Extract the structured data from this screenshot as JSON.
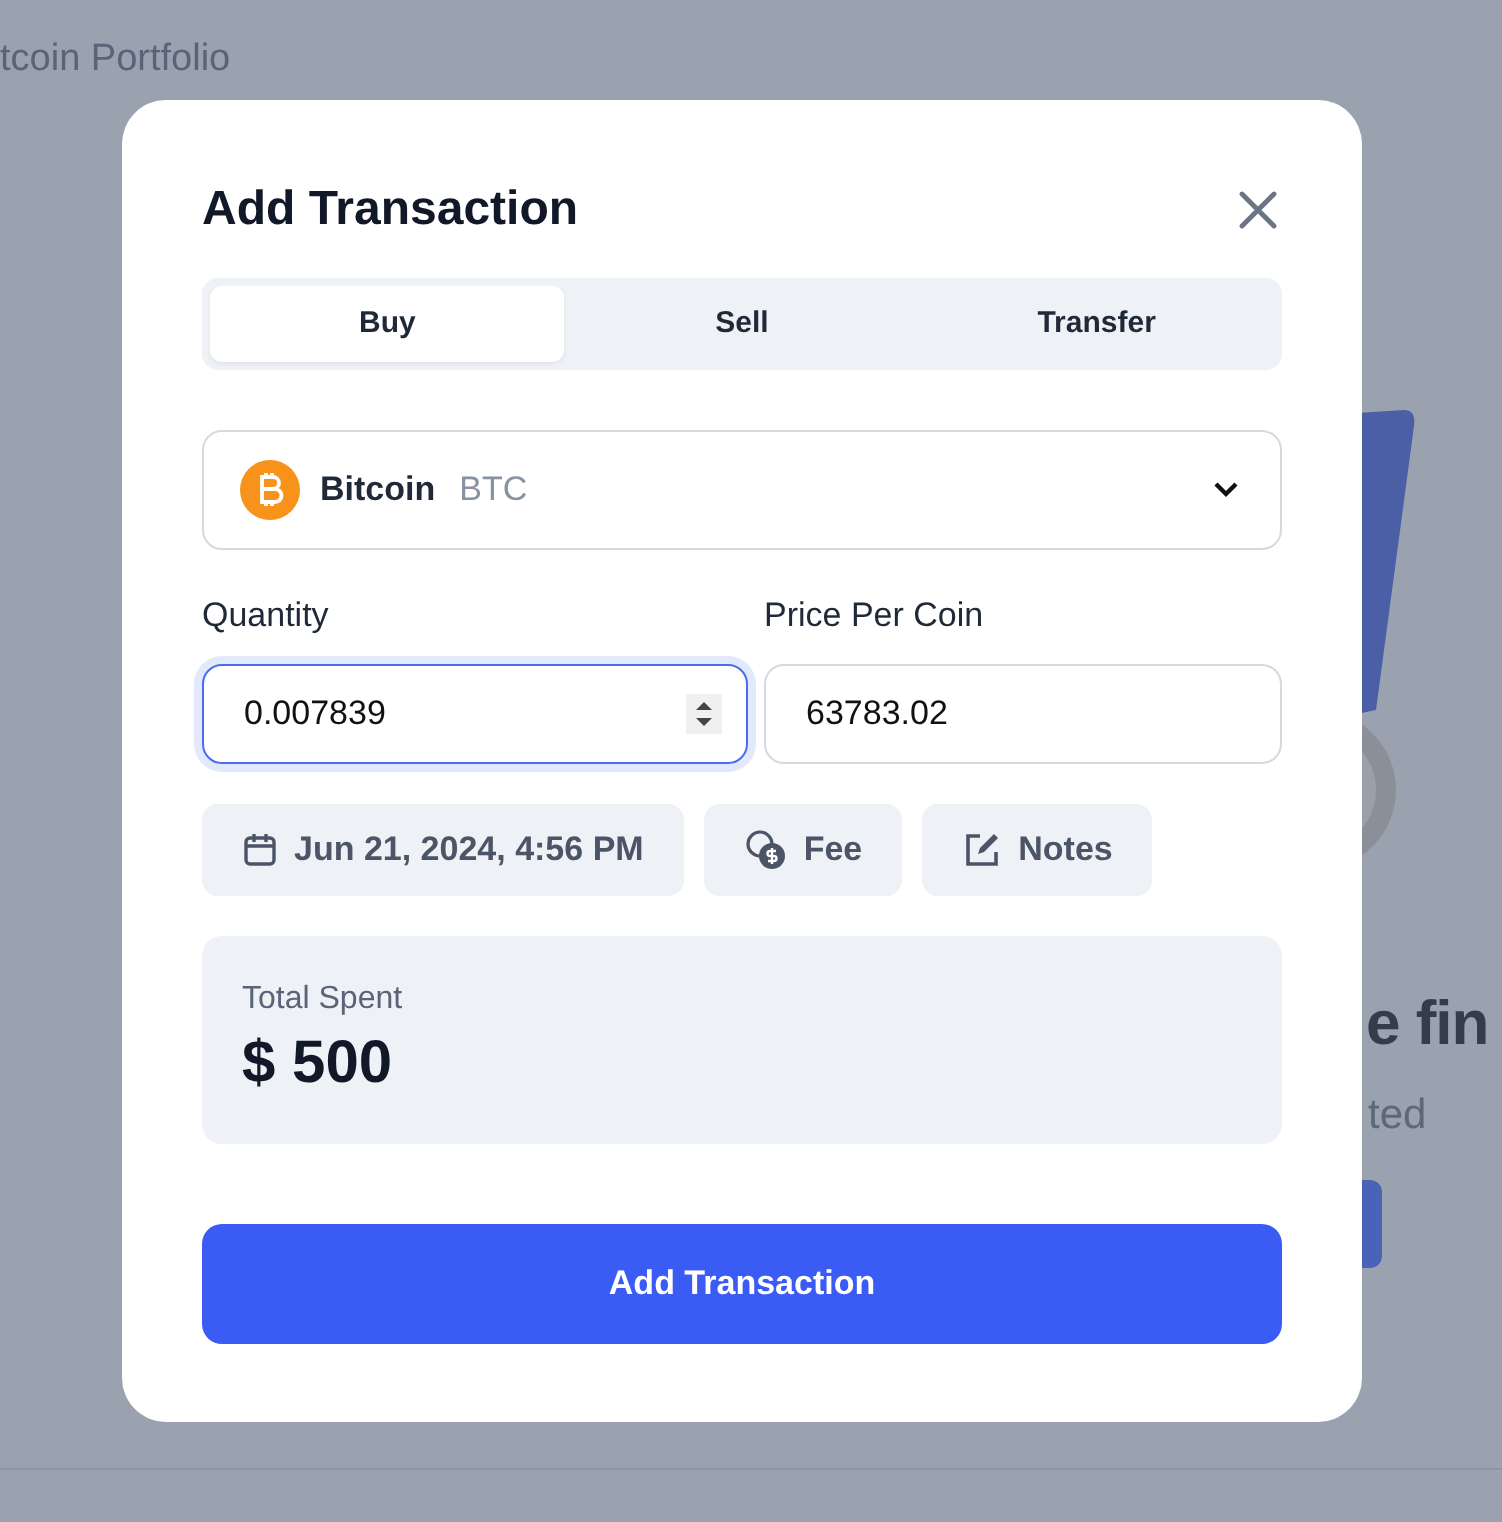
{
  "background": {
    "title": "tcoin Portfolio",
    "heading": "e fin",
    "subtitle": "ted"
  },
  "modal": {
    "title": "Add Transaction",
    "tabs": [
      {
        "label": "Buy",
        "selected": true
      },
      {
        "label": "Sell",
        "selected": false
      },
      {
        "label": "Transfer",
        "selected": false
      }
    ],
    "coin": {
      "name": "Bitcoin",
      "symbol": "BTC"
    },
    "fields": [
      {
        "label": "Quantity",
        "value": "0.007839",
        "kind": "number",
        "focused": true
      },
      {
        "label": "Price Per Coin",
        "value": "63783.02",
        "kind": "text",
        "focused": false
      }
    ],
    "chips": [
      {
        "kind": "date",
        "label": "Jun 21, 2024, 4:56 PM"
      },
      {
        "kind": "fee",
        "label": "Fee"
      },
      {
        "kind": "notes",
        "label": "Notes"
      }
    ],
    "total": {
      "label": "Total Spent",
      "value": "$ 500"
    },
    "submit": "Add Transaction"
  }
}
